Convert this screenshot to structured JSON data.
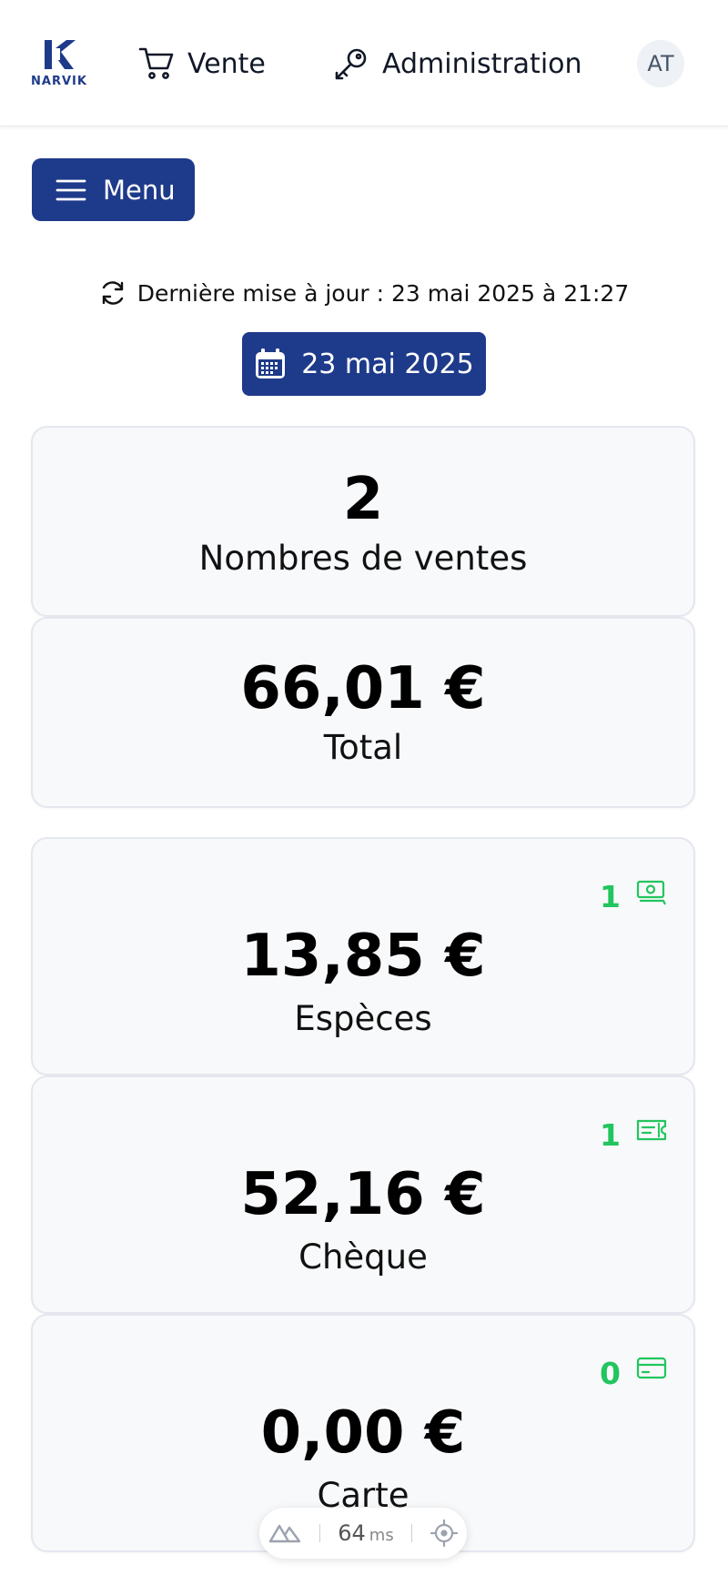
{
  "header": {
    "logo_text": "NARVIK",
    "nav": [
      {
        "label": "Vente",
        "icon": "cart-icon"
      },
      {
        "label": "Administration",
        "icon": "key-icon"
      }
    ],
    "avatar_initials": "AT"
  },
  "menu_button": {
    "label": "Menu",
    "icon": "hamburger-icon"
  },
  "last_update": {
    "text": "Dernière mise à jour : 23 mai 2025 à 21:27",
    "icon": "refresh-icon"
  },
  "date_button": {
    "label": "23 mai 2025",
    "icon": "calendar-icon"
  },
  "summary": {
    "sales_count": {
      "value": "2",
      "label": "Nombres de ventes"
    },
    "total": {
      "value": "66,01 €",
      "label": "Total"
    }
  },
  "payments": [
    {
      "value": "13,85 €",
      "label": "Espèces",
      "count": "1",
      "icon": "cash-icon"
    },
    {
      "value": "52,16 €",
      "label": "Chèque",
      "count": "1",
      "icon": "cheque-icon"
    },
    {
      "value": "0,00 €",
      "label": "Carte",
      "count": "0",
      "icon": "credit-card-icon"
    }
  ],
  "devtools": {
    "response_time": "64",
    "unit": "ms",
    "icon": "nuxt-logo-icon"
  },
  "colors": {
    "primary": "#1e3a8a",
    "count_green": "#22c55e",
    "card_bg": "#f8f9fb",
    "card_border": "#e4e7ee"
  }
}
